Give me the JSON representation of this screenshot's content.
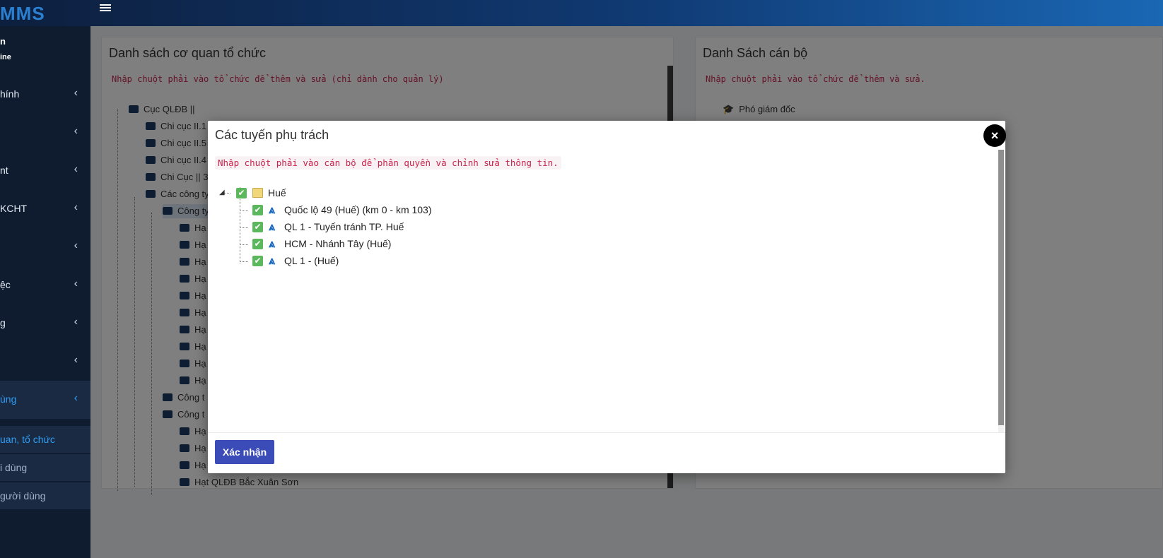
{
  "app": {
    "logo": "MMS"
  },
  "sidebar": {
    "user_name": "n",
    "user_status": "ine",
    "items": [
      {
        "label": "hính"
      },
      {
        "label": ""
      },
      {
        "label": "nt"
      },
      {
        "label": "KCHT"
      },
      {
        "label": ""
      },
      {
        "label": "ệc"
      },
      {
        "label": "g"
      },
      {
        "label": ""
      },
      {
        "label": "ùng"
      }
    ],
    "subitems": [
      {
        "label": "uan, tổ chức"
      },
      {
        "label": "i dùng"
      },
      {
        "label": "gười dùng"
      }
    ]
  },
  "left_panel": {
    "title": "Danh sách cơ quan tổ chức",
    "hint": "Nhập chuột phải vào tổ chức để thêm và sửa (chỉ dành cho quản lý)",
    "tree": [
      {
        "label": "Cục QLĐB ||"
      },
      {
        "label": "Chi cục II.1"
      },
      {
        "label": "Chi cục II.5"
      },
      {
        "label": "Chi cục II.4"
      },
      {
        "label": "Chi Cục || 3"
      },
      {
        "label": "Các công ty"
      },
      {
        "label": "Công ty"
      },
      {
        "label": "Hạ"
      },
      {
        "label": "Hạ"
      },
      {
        "label": "Hạ"
      },
      {
        "label": "Hạ"
      },
      {
        "label": "Hạ"
      },
      {
        "label": "Hạ"
      },
      {
        "label": "Hạ"
      },
      {
        "label": "Hạ"
      },
      {
        "label": "Hạ"
      },
      {
        "label": "Hạ"
      },
      {
        "label": "Công t"
      },
      {
        "label": "Công t"
      },
      {
        "label": "Hạ"
      },
      {
        "label": "Hạ"
      },
      {
        "label": "Hạ"
      },
      {
        "label": "Hạt QLĐB Bắc Xuân Sơn"
      }
    ]
  },
  "right_panel": {
    "title": "Danh Sách cán bộ",
    "hint": "Nhập chuột phải vào tổ chức để thêm và sửa.",
    "tree": [
      {
        "label": "Phó giám đốc"
      }
    ]
  },
  "modal": {
    "title": "Các tuyến phụ trách",
    "close": "×",
    "hint": "Nhập chuột phải vào cán bộ để phân quyền và chỉnh sửa thông tin.",
    "root": "Huế",
    "routes": [
      {
        "label": "Quốc lộ 49 (Huế) (km 0 - km 103)"
      },
      {
        "label": "QL 1 - Tuyến tránh TP. Huế"
      },
      {
        "label": "HCM - Nhánh Tây (Huế)"
      },
      {
        "label": "QL 1 - (Huế)"
      }
    ],
    "confirm": "Xác nhận"
  },
  "colors": {
    "accent": "#2f9cf1",
    "confirm_button": "#3b4cb8",
    "check": "#5cb85c",
    "hint_text": "#c7254e"
  }
}
